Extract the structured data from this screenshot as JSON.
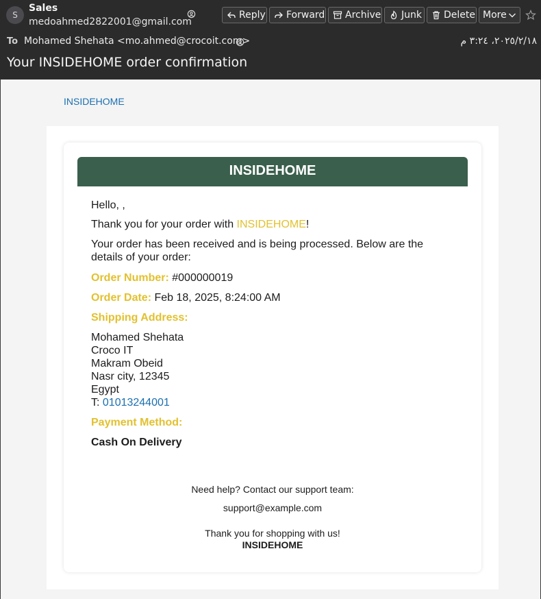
{
  "header": {
    "avatar_letter": "S",
    "from_name": "Sales",
    "from_email": "medoahmed2822001@gmail.com",
    "to_label": "To",
    "to_value": "Mohamed Shehata <mo.ahmed@crocoit.com>",
    "date": "٢٠٢٥/٢/١٨، ٣:٢٤ م",
    "subject": "Your INSIDEHOME order confirmation",
    "buttons": {
      "reply": "Reply",
      "forward": "Forward",
      "archive": "Archive",
      "junk": "Junk",
      "delete": "Delete",
      "more": "More"
    }
  },
  "email": {
    "top_link": "INSIDEHOME",
    "banner_title": "INSIDEHOME",
    "greeting": "Hello, ,",
    "thanks_prefix": "Thank you for your order with ",
    "thanks_brand": "INSIDEHOME",
    "thanks_suffix": "!",
    "received_line1": "Your order has been received and is being processed. Below are the",
    "received_line2": "details of your order:",
    "order_number_label": "Order Number:",
    "order_number_value": "#000000019",
    "order_date_label": "Order Date:",
    "order_date_value": "Feb 18, 2025, 8:24:00 AM",
    "shipping_label": "Shipping Address:",
    "address": {
      "name": "Mohamed Shehata",
      "company": "Croco IT",
      "street": "Makram Obeid",
      "city": "Nasr city, 12345",
      "country": "Egypt",
      "phone_prefix": "T: ",
      "phone": "01013244001"
    },
    "payment_label": "Payment Method:",
    "payment_value": "Cash On Delivery",
    "help_text": "Need help? Contact our support team:",
    "support_email": "support@example.com",
    "closing": "Thank you for shopping with us!",
    "signature": "INSIDEHOME"
  },
  "colors": {
    "banner": "#3a5f4c",
    "accent_yellow": "#e2c12f",
    "link_blue": "#1a6fb0",
    "header_bg": "#2b2b2b"
  }
}
